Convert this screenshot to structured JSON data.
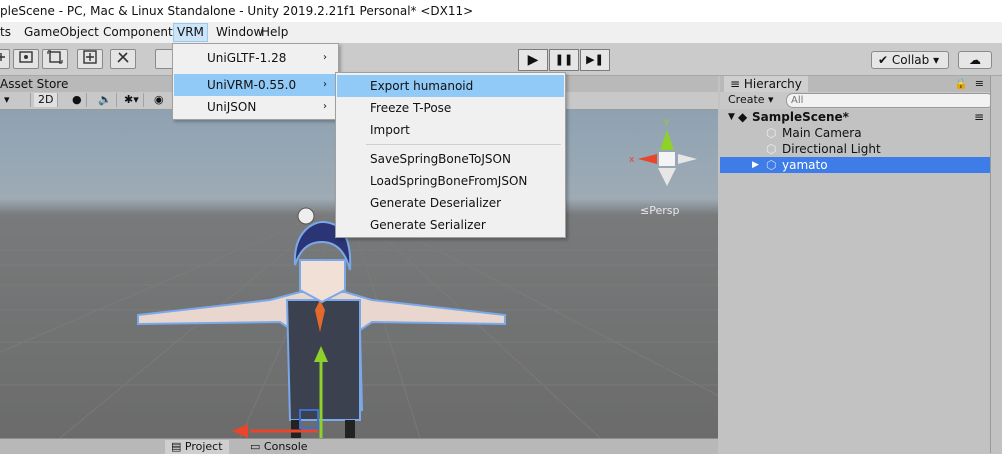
{
  "window": {
    "title": "pleScene - PC, Mac & Linux Standalone - Unity 2019.2.21f1 Personal* <DX11>"
  },
  "menubar": {
    "items": [
      "ts",
      "GameObject",
      "Component",
      "VRM",
      "Window",
      "Help"
    ]
  },
  "toolbar": {
    "play_icon": "▶",
    "pause_icon": "❚❚",
    "step_icon": "▶❚",
    "collab_label": "Collab",
    "collab_arrow": "▾",
    "cloud_icon": "☁"
  },
  "scene": {
    "tab_label": "Asset Store",
    "mode_2d": "2D",
    "persp_label": "≤Persp",
    "gizmo": {
      "x": "x",
      "y": "y"
    }
  },
  "bottom_tabs": {
    "project": "Project",
    "console": "Console"
  },
  "hierarchy": {
    "tab_label": "Hierarchy",
    "create_label": "Create",
    "search_placeholder": "All",
    "scene_name": "SampleScene*",
    "items": [
      "Main Camera",
      "Directional Light",
      "yamato"
    ],
    "selected": "yamato"
  },
  "vrm_menu": {
    "items": [
      {
        "label": "UniGLTF-1.28",
        "has_submenu": true
      },
      {
        "label": "UniVRM-0.55.0",
        "has_submenu": true,
        "highlighted": true
      },
      {
        "label": "UniJSON",
        "has_submenu": true
      }
    ],
    "arrow": "›"
  },
  "univrm_submenu": {
    "items": [
      {
        "label": "Export humanoid",
        "highlighted": true
      },
      {
        "label": "Freeze T-Pose"
      },
      {
        "label": "Import"
      },
      {
        "label": "SaveSpringBoneToJSON"
      },
      {
        "label": "LoadSpringBoneFromJSON"
      },
      {
        "label": "Generate Deserializer"
      },
      {
        "label": "Generate Serializer"
      }
    ]
  },
  "colors": {
    "selection": "#3e7de7",
    "menu_highlight": "#91c9f7",
    "gizmo_x": "#e8452a",
    "gizmo_y": "#8fd12b",
    "gizmo_z": "#3b6fd1"
  }
}
